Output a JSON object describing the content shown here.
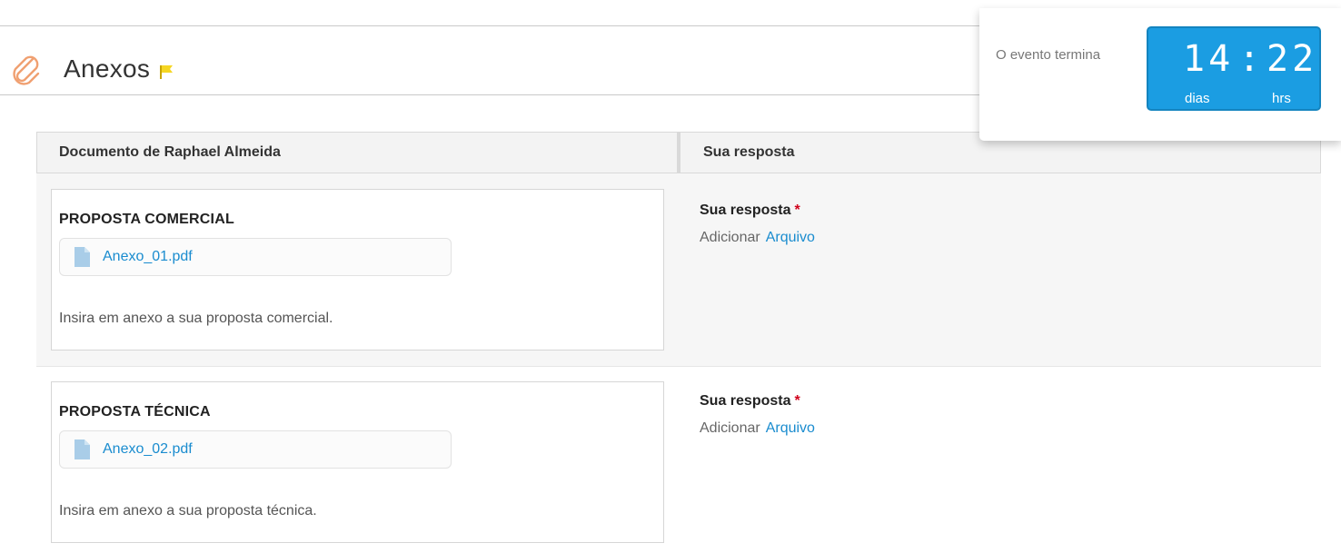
{
  "section": {
    "title": "Anexos",
    "icon": "paperclip-icon",
    "flag_icon": "flag-icon",
    "flag_color": "#f5d623",
    "clip_color": "#f0a071"
  },
  "table": {
    "headers": {
      "document": "Documento de Raphael Almeida",
      "response": "Sua resposta"
    },
    "rows": [
      {
        "title": "PROPOSTA COMERCIAL",
        "file": "Anexo_01.pdf",
        "description": "Insira em anexo a sua proposta comercial.",
        "answer_label": "Sua resposta",
        "required_mark": "*",
        "add_text": "Adicionar",
        "file_action": "Arquivo"
      },
      {
        "title": "PROPOSTA TÉCNICA",
        "file": "Anexo_02.pdf",
        "description": "Insira em anexo a sua proposta técnica.",
        "answer_label": "Sua resposta",
        "required_mark": "*",
        "add_text": "Adicionar",
        "file_action": "Arquivo"
      }
    ]
  },
  "countdown": {
    "label": "O evento termina",
    "days": "14",
    "separator": ":",
    "hours": "22",
    "days_unit": "dias",
    "hours_unit": "hrs",
    "color": "#1b9de2"
  },
  "colors": {
    "link": "#1a8ccf",
    "required": "#d0021b"
  }
}
